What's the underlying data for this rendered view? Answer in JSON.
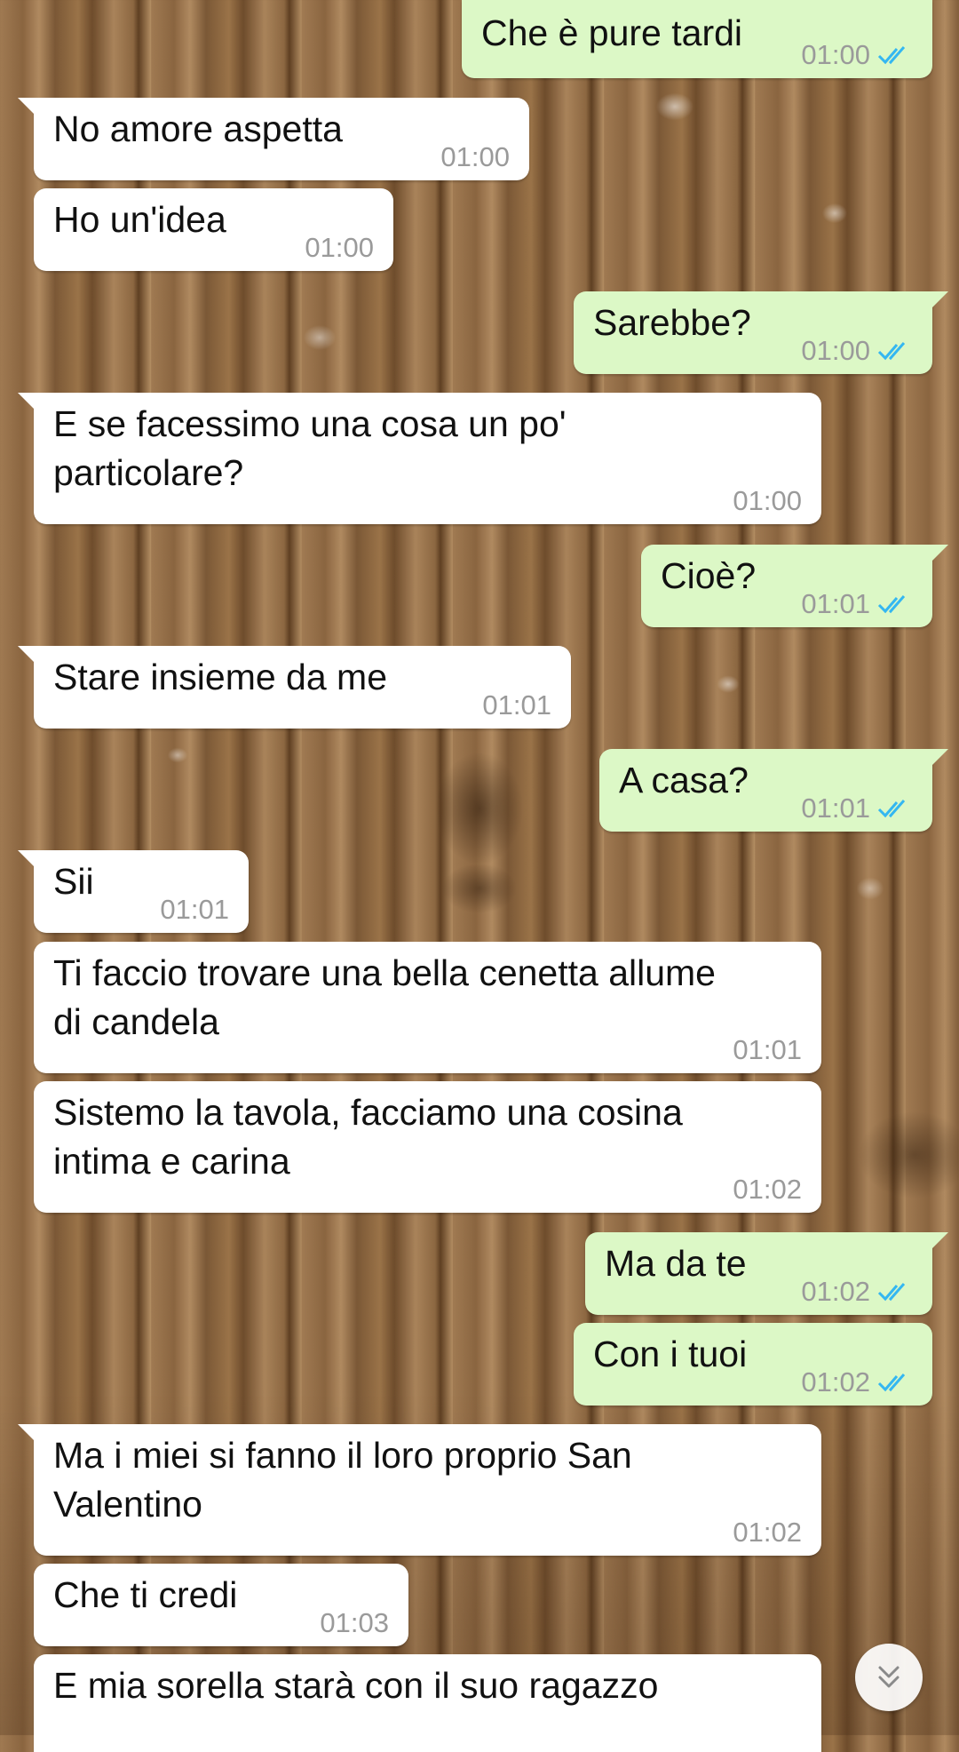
{
  "messages": [
    {
      "dir": "out",
      "text": "Che è pure tardi",
      "time": "01:00",
      "read": true
    },
    {
      "dir": "in",
      "text": "No amore aspetta",
      "time": "01:00"
    },
    {
      "dir": "in",
      "text": "Ho un'idea",
      "time": "01:00"
    },
    {
      "dir": "out",
      "text": "Sarebbe?",
      "time": "01:00",
      "read": true
    },
    {
      "dir": "in",
      "text_lines": [
        "E se facessimo una cosa un po'",
        "particolare?"
      ],
      "time": "01:00"
    },
    {
      "dir": "out",
      "text": "Cioè?",
      "time": "01:01",
      "read": true
    },
    {
      "dir": "in",
      "text": "Stare insieme da me",
      "time": "01:01"
    },
    {
      "dir": "out",
      "text": "A casa?",
      "time": "01:01",
      "read": true
    },
    {
      "dir": "in",
      "text": "Sii",
      "time": "01:01"
    },
    {
      "dir": "in",
      "text_lines": [
        "Ti faccio trovare una bella cenetta allume",
        "di candela"
      ],
      "time": "01:01"
    },
    {
      "dir": "in",
      "text_lines": [
        "Sistemo la tavola, facciamo una cosina",
        "intima e carina"
      ],
      "time": "01:02"
    },
    {
      "dir": "out",
      "text": "Ma da te",
      "time": "01:02",
      "read": true
    },
    {
      "dir": "out",
      "text": "Con i tuoi",
      "time": "01:02",
      "read": true
    },
    {
      "dir": "in",
      "text_lines": [
        "Ma i miei si fanno il loro proprio San",
        "Valentino"
      ],
      "time": "01:02"
    },
    {
      "dir": "in",
      "text": "Che ti credi",
      "time": "01:03"
    },
    {
      "dir": "in",
      "text": "E mia sorella starà con il suo ragazzo",
      "time": ""
    }
  ],
  "scroll_button": {
    "icon": "double-chevron-down-icon"
  },
  "colors": {
    "incoming": "#ffffff",
    "outgoing": "#dcf8c6",
    "time": "#9a9a9a",
    "read_ticks": "#34b7f1"
  }
}
